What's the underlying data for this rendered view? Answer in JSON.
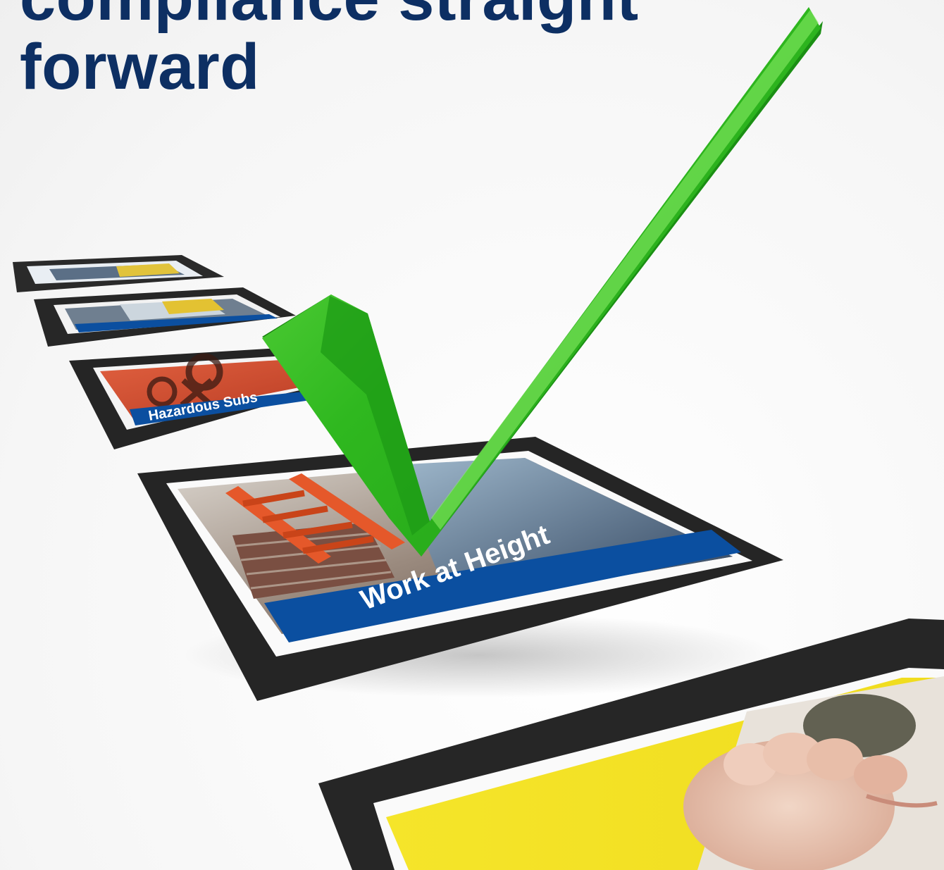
{
  "headline": {
    "line1": "compliance straight",
    "line2": "forward"
  },
  "cards": [
    {
      "label": ""
    },
    {
      "label": ""
    },
    {
      "label": "Hazardous Subs"
    },
    {
      "label": "Work at Height"
    },
    {
      "label": ""
    }
  ],
  "checkmark": {
    "icon": "checkmark-icon",
    "color": "#2fb81f"
  },
  "colors": {
    "headline": "#0d2f63",
    "banner": "#0b4fa0",
    "frame": "#262626",
    "check_light": "#3cc92a",
    "check_dark": "#1c8f14"
  }
}
